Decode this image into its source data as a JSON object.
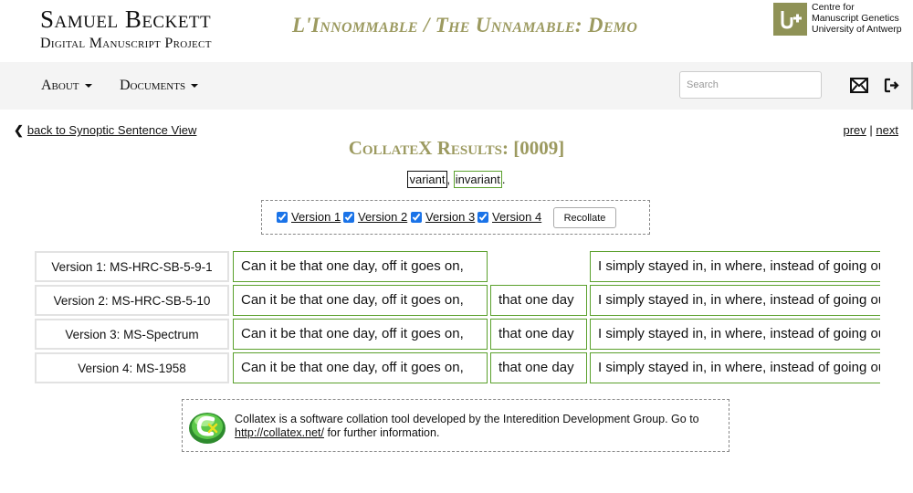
{
  "header": {
    "title_line1": "Samuel Beckett",
    "title_line2": "Digital Manuscript Project",
    "demo_title": "L'Innommable / The Unnamable: Demo",
    "cmg_lines": [
      "Centre for",
      "Manuscript Genetics",
      "University of Antwerp"
    ]
  },
  "nav": {
    "about": "About",
    "documents": "Documents",
    "search_placeholder": "Search",
    "mail_icon": "envelope-icon",
    "logout_icon": "sign-out-icon"
  },
  "content": {
    "back_link": "back to Synoptic Sentence View",
    "prev": "prev",
    "separator": "|",
    "next": "next",
    "heading": "CollateX Results: [0009]",
    "legend": {
      "variant": "variant",
      "comma": ",",
      "invariant": "invariant",
      "period": "."
    },
    "versions": [
      "Version 1",
      "Version 2",
      "Version 3",
      "Version 4"
    ],
    "recollate": "Recollate"
  },
  "table": {
    "rows": [
      {
        "label": "Version 1: MS-HRC-SB-5-9-1",
        "seg1": "Can it be that one day, off it goes on,",
        "seg2": "",
        "seg3": "I simply stayed in, in where, instead of going out"
      },
      {
        "label": "Version 2: MS-HRC-SB-5-10",
        "seg1": "Can it be that one day, off it goes on,",
        "seg2": "that one day",
        "seg3": "I simply stayed in, in where, instead of going out"
      },
      {
        "label": "Version 3: MS-Spectrum",
        "seg1": "Can it be that one day, off it goes on,",
        "seg2": "that one day",
        "seg3": "I simply stayed in, in where, instead of going out"
      },
      {
        "label": "Version 4: MS-1958",
        "seg1": "Can it be that one day, off it goes on,",
        "seg2": "that one day",
        "seg3": "I simply stayed in, in where, instead of going out"
      }
    ]
  },
  "collatex": {
    "text_before": "Collatex is a software collation tool developed by the Interedition Development Group. Go to",
    "link": "http://collatex.net/",
    "text_after": " for further information."
  },
  "colors": {
    "accent_olive": "#9c9a60",
    "invariant_green": "#5aa02c"
  }
}
